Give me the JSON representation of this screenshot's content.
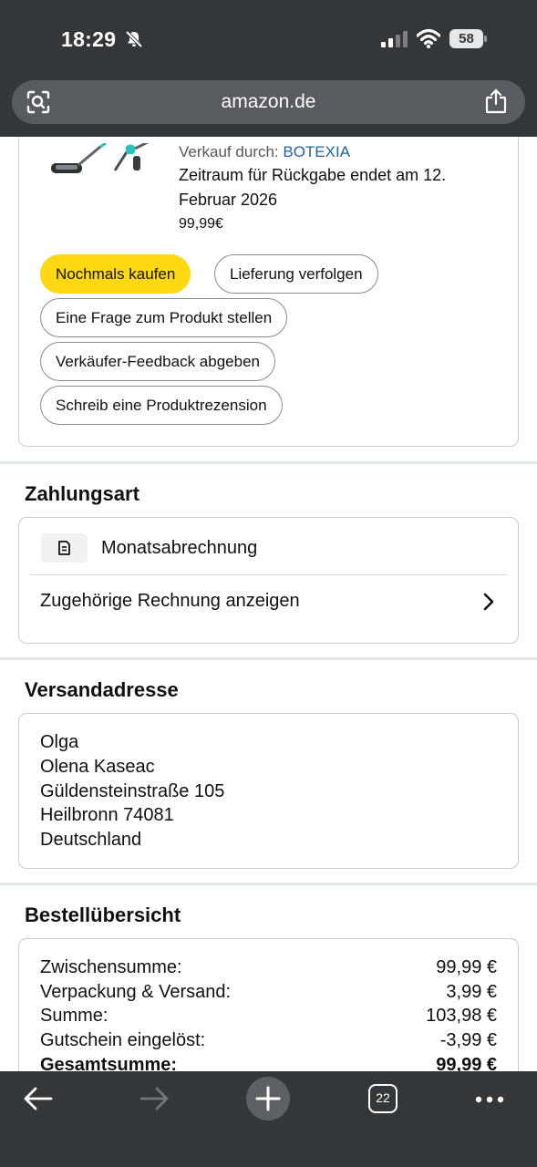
{
  "status_bar": {
    "time": "18:29",
    "battery": "58"
  },
  "browser": {
    "url": "amazon.de",
    "open_tabs": "22"
  },
  "order_item": {
    "seller_prefix": "Verkauf durch:",
    "seller_name": "BOTEXIA",
    "return_line_1": "Zeitraum für Rückgabe endet am 12.",
    "return_line_2": "Februar 2026",
    "price": "99,99€",
    "actions": {
      "buy_again": "Nochmals kaufen",
      "track": "Lieferung verfolgen",
      "question": "Eine Frage zum Produkt stellen",
      "seller_feedback": "Verkäufer-Feedback abgeben",
      "review": "Schreib eine Produktrezension"
    }
  },
  "payment": {
    "title": "Zahlungsart",
    "method": "Monatsabrechnung",
    "invoice_link": "Zugehörige Rechnung anzeigen"
  },
  "shipping": {
    "title": "Versandadresse",
    "lines": [
      "Olga",
      "Olena Kaseac",
      "Güldensteinstraße 105",
      "Heilbronn 74081",
      "Deutschland"
    ]
  },
  "summary": {
    "title": "Bestellübersicht",
    "rows": [
      {
        "label": "Zwischensumme:",
        "value": "99,99 €"
      },
      {
        "label": "Verpackung & Versand:",
        "value": "3,99 €"
      },
      {
        "label": "Summe:",
        "value": "103,98 €"
      },
      {
        "label": "Gutschein eingelöst:",
        "value": "-3,99 €"
      },
      {
        "label": "Gesamtsumme:",
        "value": "99,99 €"
      }
    ]
  },
  "colors": {
    "primary_button": "#ffd814",
    "link": "#2162a1",
    "chrome": "#33373a"
  }
}
